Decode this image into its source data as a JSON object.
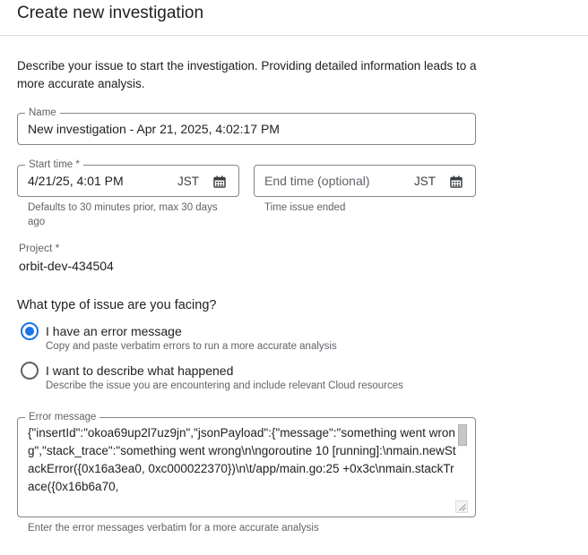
{
  "dialog": {
    "title": "Create new investigation",
    "description": "Describe your issue to start the investigation. Providing detailed information leads to a more accurate analysis."
  },
  "name_field": {
    "label": "Name",
    "value": "New investigation - Apr 21, 2025, 4:02:17 PM"
  },
  "start_time": {
    "label": "Start time *",
    "value": "4/21/25, 4:01 PM",
    "timezone": "JST",
    "icon": "calendar-icon",
    "hint": "Defaults to 30 minutes prior, max 30 days ago"
  },
  "end_time": {
    "placeholder": "End time (optional)",
    "timezone": "JST",
    "icon": "calendar-icon",
    "hint": "Time issue ended"
  },
  "project": {
    "label": "Project *",
    "value": "orbit-dev-434504"
  },
  "issue_type": {
    "question": "What type of issue are you facing?",
    "options": [
      {
        "label": "I have an error message",
        "description": "Copy and paste verbatim errors to run a more accurate analysis",
        "selected": true
      },
      {
        "label": "I want to describe what happened",
        "description": "Describe the issue you are encountering and include relevant Cloud resources",
        "selected": false
      }
    ]
  },
  "error_message": {
    "label": "Error message",
    "value": "{\"insertId\":\"okoa69up2l7uz9jn\",\"jsonPayload\":{\"message\":\"something went wrong\",\"stack_trace\":\"something went wrong\\n\\ngoroutine 10 [running]:\\nmain.newStackError({0x16a3ea0, 0xc000022370})\\n\\t/app/main.go:25 +0x3c\\nmain.stackTrace({0x16b6a70,",
    "hint": "Enter the error messages verbatim for a more accurate analysis"
  },
  "colors": {
    "accent": "#1a73e8",
    "border": "#80868b",
    "muted_text": "#5f6368"
  }
}
